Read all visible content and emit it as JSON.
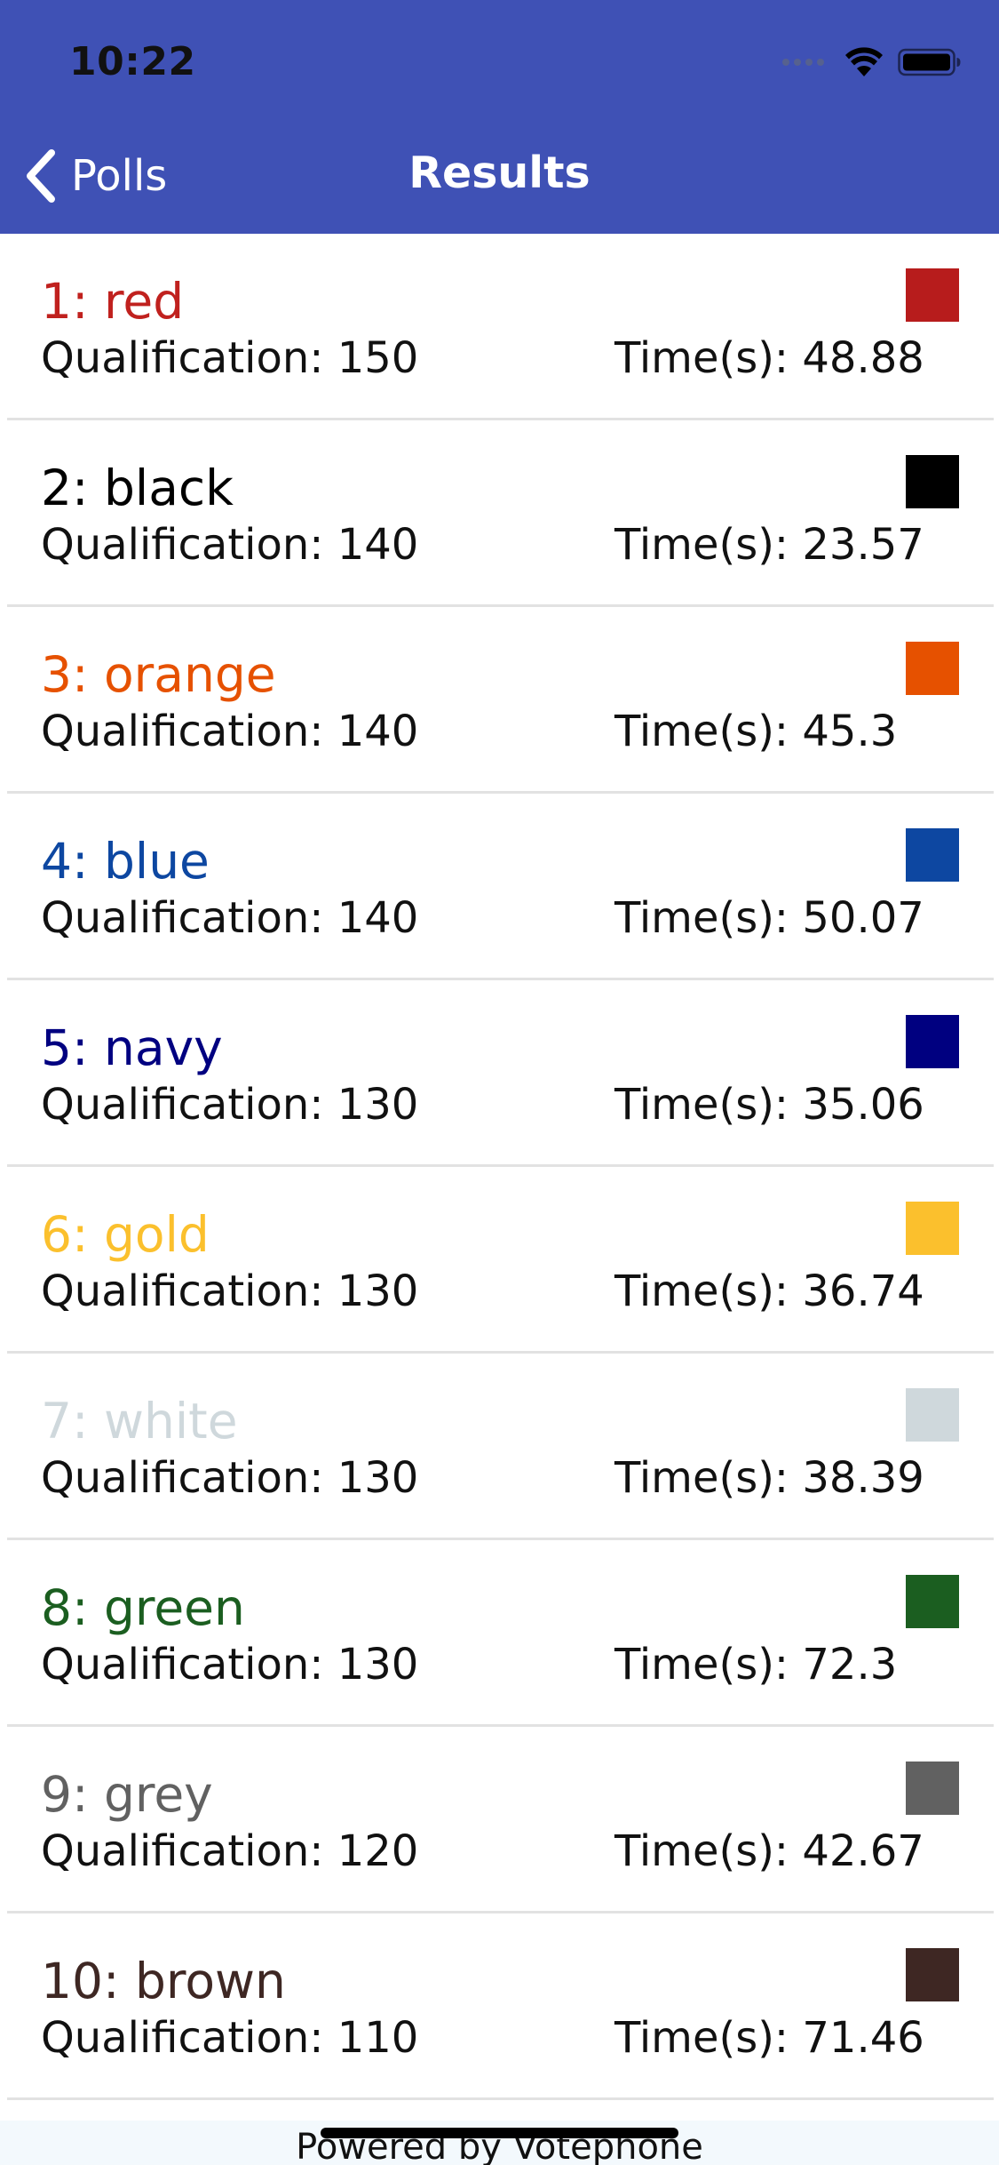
{
  "status_bar": {
    "time": "10:22",
    "icons": [
      "cellular-signal-icon",
      "wifi-icon",
      "battery-icon"
    ]
  },
  "nav": {
    "back_label": "Polls",
    "title": "Results",
    "background_color": "#3f51b5"
  },
  "results": [
    {
      "rank_label": "1: red",
      "title_color": "#c0211e",
      "swatch_color": "#b71c1c",
      "qualification": "Qualification: 150",
      "time": "Time(s): 48.88"
    },
    {
      "rank_label": "2: black",
      "title_color": "#000000",
      "swatch_color": "#000000",
      "qualification": "Qualification: 140",
      "time": "Time(s): 23.57"
    },
    {
      "rank_label": "3: orange",
      "title_color": "#e65100",
      "swatch_color": "#e65100",
      "qualification": "Qualification: 140",
      "time": "Time(s): 45.3"
    },
    {
      "rank_label": "4: blue",
      "title_color": "#0d47a1",
      "swatch_color": "#0d47a1",
      "qualification": "Qualification: 140",
      "time": "Time(s): 50.07"
    },
    {
      "rank_label": "5: navy",
      "title_color": "#000080",
      "swatch_color": "#000080",
      "qualification": "Qualification: 130",
      "time": "Time(s): 35.06"
    },
    {
      "rank_label": "6: gold",
      "title_color": "#fbc02d",
      "swatch_color": "#fbc02d",
      "qualification": "Qualification: 130",
      "time": "Time(s): 36.74"
    },
    {
      "rank_label": "7: white",
      "title_color": "#cfd8dc",
      "swatch_color": "#cfd8dc",
      "qualification": "Qualification: 130",
      "time": "Time(s): 38.39"
    },
    {
      "rank_label": "8: green",
      "title_color": "#1b5e20",
      "swatch_color": "#1b5e20",
      "qualification": "Qualification: 130",
      "time": "Time(s): 72.3"
    },
    {
      "rank_label": "9: grey",
      "title_color": "#616161",
      "swatch_color": "#616161",
      "qualification": "Qualification: 120",
      "time": "Time(s): 42.67"
    },
    {
      "rank_label": "10: brown",
      "title_color": "#3e2723",
      "swatch_color": "#3e2723",
      "qualification": "Qualification: 110",
      "time": "Time(s): 71.46"
    }
  ],
  "footer": {
    "text": "Powered by Votephone",
    "background_color": "#f3f9fd"
  }
}
